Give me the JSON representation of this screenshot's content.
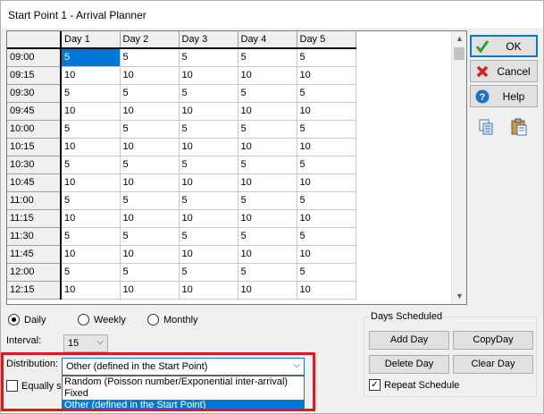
{
  "window": {
    "title": "Start Point 1 - Arrival Planner"
  },
  "grid": {
    "columns": [
      "Day 1",
      "Day 2",
      "Day 3",
      "Day 4",
      "Day 5"
    ],
    "rows": [
      {
        "time": "09:00",
        "values": [
          "5",
          "5",
          "5",
          "5",
          "5"
        ]
      },
      {
        "time": "09:15",
        "values": [
          "10",
          "10",
          "10",
          "10",
          "10"
        ]
      },
      {
        "time": "09:30",
        "values": [
          "5",
          "5",
          "5",
          "5",
          "5"
        ]
      },
      {
        "time": "09:45",
        "values": [
          "10",
          "10",
          "10",
          "10",
          "10"
        ]
      },
      {
        "time": "10:00",
        "values": [
          "5",
          "5",
          "5",
          "5",
          "5"
        ]
      },
      {
        "time": "10:15",
        "values": [
          "10",
          "10",
          "10",
          "10",
          "10"
        ]
      },
      {
        "time": "10:30",
        "values": [
          "5",
          "5",
          "5",
          "5",
          "5"
        ]
      },
      {
        "time": "10:45",
        "values": [
          "10",
          "10",
          "10",
          "10",
          "10"
        ]
      },
      {
        "time": "11:00",
        "values": [
          "5",
          "5",
          "5",
          "5",
          "5"
        ]
      },
      {
        "time": "11:15",
        "values": [
          "10",
          "10",
          "10",
          "10",
          "10"
        ]
      },
      {
        "time": "11:30",
        "values": [
          "5",
          "5",
          "5",
          "5",
          "5"
        ]
      },
      {
        "time": "11:45",
        "values": [
          "10",
          "10",
          "10",
          "10",
          "10"
        ]
      },
      {
        "time": "12:00",
        "values": [
          "5",
          "5",
          "5",
          "5",
          "5"
        ]
      },
      {
        "time": "12:15",
        "values": [
          "10",
          "10",
          "10",
          "10",
          "10"
        ]
      }
    ],
    "selected_cell": "09:00 / Day 1"
  },
  "buttons": {
    "ok": "OK",
    "cancel": "Cancel",
    "help": "Help",
    "copy_icon": "copy-icon",
    "paste_icon": "paste-icon"
  },
  "schedule": {
    "daily": "Daily",
    "weekly": "Weekly",
    "monthly": "Monthly",
    "selected": "Daily"
  },
  "interval": {
    "label": "Interval:",
    "value": "15"
  },
  "distribution": {
    "label": "Distribution:",
    "value": "Other (defined in the Start Point)",
    "options": [
      "Random (Poisson number/Exponential inter-arrival)",
      "Fixed",
      "Other (defined in the Start Point)"
    ]
  },
  "equally_spaced": {
    "label_visible": "Equally sp",
    "checked": false
  },
  "days_scheduled": {
    "title": "Days Scheduled",
    "add_day": "Add Day",
    "copy_day": "CopyDay",
    "delete_day": "Delete Day",
    "clear_day": "Clear Day",
    "repeat_schedule": "Repeat Schedule",
    "repeat_checked": true
  },
  "colors": {
    "selection": "#0078d7",
    "highlight_frame": "#e8131b",
    "ok_check": "#2e9e2e",
    "cancel_x": "#d22020",
    "help_circle": "#1f6fc4"
  }
}
